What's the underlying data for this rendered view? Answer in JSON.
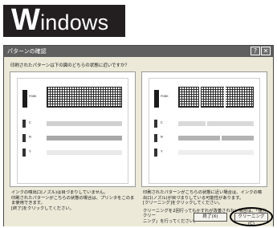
{
  "os_banner": {
    "first_letter": "W",
    "rest": "indows"
  },
  "dialog": {
    "title": "パターンの確認",
    "help_button": "?",
    "close_button": "✕",
    "question": "印刷されたパターンは下の図のどちらの状態に近いですか？",
    "left_option": {
      "labels": {
        "black": "PGBK",
        "cyan": "C",
        "magenta": "M",
        "yellow": "Y"
      },
      "description": [
        "インクの噴出口(ノズル)は目づまりしていません。",
        "印刷されたパターンがこちらの状態の場合は、プリンタをこのま",
        "ま使用できます。",
        "[終了]をクリックしてください。"
      ]
    },
    "right_option": {
      "labels": {
        "black": "PGBK",
        "cyan": "C",
        "magenta": "M",
        "yellow": "Y"
      },
      "description": [
        "印刷されたパターンがこちらの状態に近い場合は、インクの噴",
        "出口(ノズル)が目づまりしている可能性があります。",
        "[クリーニング]をクリックしてください。",
        "",
        "クリーニングを2回行ってもかすれが改善されない場合は、「強力クリー",
        "ニング」を行ってください。"
      ]
    },
    "buttons": {
      "exit": "終了(X)",
      "cleaning": "クリーニング(C)"
    }
  }
}
